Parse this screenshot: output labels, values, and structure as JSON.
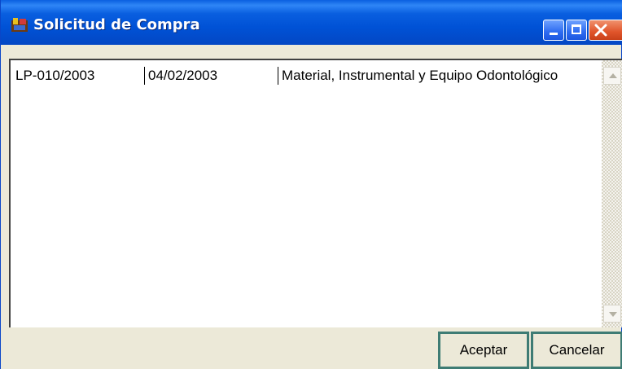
{
  "window": {
    "title": "Solicitud de Compra",
    "colors": {
      "titlebar": "#0a5fe0",
      "close": "#e0542a",
      "button_border": "#3e7c74"
    }
  },
  "list": {
    "rows": [
      {
        "code": "LP-010/2003",
        "date": "04/02/2003",
        "description": "Material, Instrumental y Equipo Odontológico"
      }
    ]
  },
  "buttons": {
    "ok_label": "Aceptar",
    "cancel_label": "Cancelar"
  }
}
